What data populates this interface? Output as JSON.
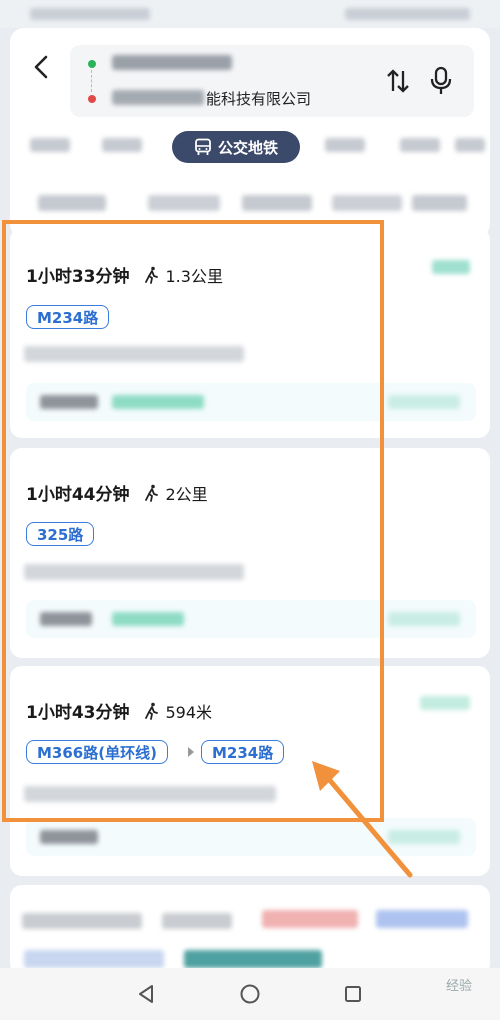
{
  "route": {
    "destination": "能科技有限公司"
  },
  "modes": {
    "active_label": "公交地铁"
  },
  "results": [
    {
      "duration": "1小时33分钟",
      "walk": "1.3公里",
      "lines": [
        "M234路"
      ]
    },
    {
      "duration": "1小时44分钟",
      "walk": "2公里",
      "lines": [
        "325路"
      ]
    },
    {
      "duration": "1小时43分钟",
      "walk": "594米",
      "lines": [
        "M366路(单环线)",
        "M234路"
      ]
    }
  ],
  "icons": {
    "back": "back-arrow-icon",
    "swap": "swap-icon",
    "mic": "mic-icon",
    "bus": "bus-icon",
    "walk": "walk-icon",
    "nav_back": "triangle-back-icon",
    "nav_home": "circle-home-icon",
    "nav_recent": "square-recent-icon"
  },
  "colors": {
    "accent_blue": "#2c6fd1",
    "active_mode": "#3b4a6b",
    "highlight_orange": "#f2913c",
    "start_dot": "#2bb35a",
    "end_dot": "#e24a4a"
  },
  "watermark": "经验"
}
